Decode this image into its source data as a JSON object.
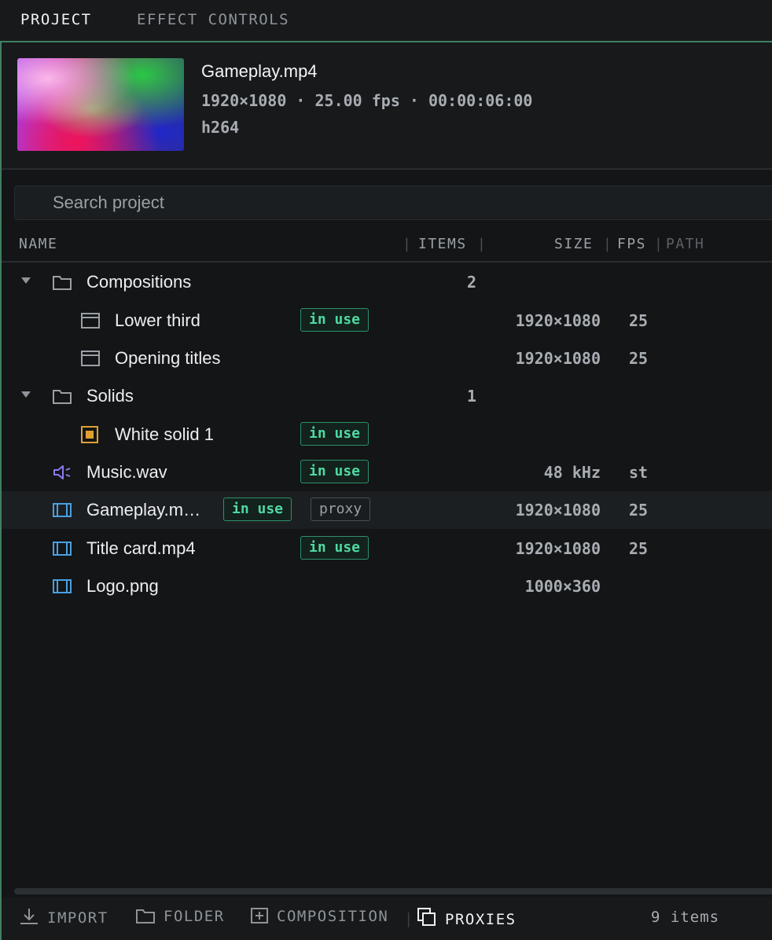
{
  "tabs": [
    {
      "label": "PROJECT",
      "active": true
    },
    {
      "label": "EFFECT CONTROLS",
      "active": false
    }
  ],
  "preview": {
    "name": "Gameplay.mp4",
    "details": "1920×1080 · 25.00 fps · 00:00:06:00",
    "codec": "h264"
  },
  "search": {
    "placeholder": "Search project",
    "value": ""
  },
  "columns": {
    "name": "NAME",
    "items": "ITEMS",
    "size": "SIZE",
    "fps": "FPS",
    "path": "PATH"
  },
  "rows": [
    {
      "label": "Compositions",
      "type": "folder",
      "items": "2",
      "size": "",
      "fps": "",
      "badges": []
    },
    {
      "label": "Lower third",
      "type": "composition",
      "items": "",
      "size": "1920×1080",
      "fps": "25",
      "badges": [
        "in use"
      ]
    },
    {
      "label": "Opening titles",
      "type": "composition",
      "items": "",
      "size": "1920×1080",
      "fps": "25",
      "badges": []
    },
    {
      "label": "Solids",
      "type": "folder",
      "items": "1",
      "size": "",
      "fps": "",
      "badges": []
    },
    {
      "label": "White solid 1",
      "type": "solid",
      "items": "",
      "size": "",
      "fps": "",
      "badges": [
        "in use"
      ]
    },
    {
      "label": "Music.wav",
      "type": "audio",
      "items": "",
      "size": "48 kHz",
      "fps": "st",
      "badges": [
        "in use"
      ]
    },
    {
      "label": "Gameplay.m…",
      "type": "video",
      "items": "",
      "size": "1920×1080",
      "fps": "25",
      "badges": [
        "in use",
        "proxy"
      ],
      "selected": true
    },
    {
      "label": "Title card.mp4",
      "type": "video",
      "items": "",
      "size": "1920×1080",
      "fps": "25",
      "badges": [
        "in use"
      ]
    },
    {
      "label": "Logo.png",
      "type": "image",
      "items": "",
      "size": "1000×360",
      "fps": "",
      "badges": []
    }
  ],
  "footer": {
    "import": "IMPORT",
    "folder": "FOLDER",
    "composition": "COMPOSITION",
    "proxies": "PROXIES",
    "count": "9 items"
  },
  "colors": {
    "accent_border": "#3f7f62",
    "in_use": "#4fd9a2",
    "solid_icon": "#e0a030",
    "audio_icon": "#8a7cf0",
    "video_icon": "#4aa0e0"
  },
  "icons": {
    "folder": "folder-icon",
    "composition": "composition-icon",
    "solid": "solid-icon",
    "audio": "speaker-icon",
    "video": "film-icon",
    "import": "download-icon",
    "proxies": "copy-icon"
  }
}
